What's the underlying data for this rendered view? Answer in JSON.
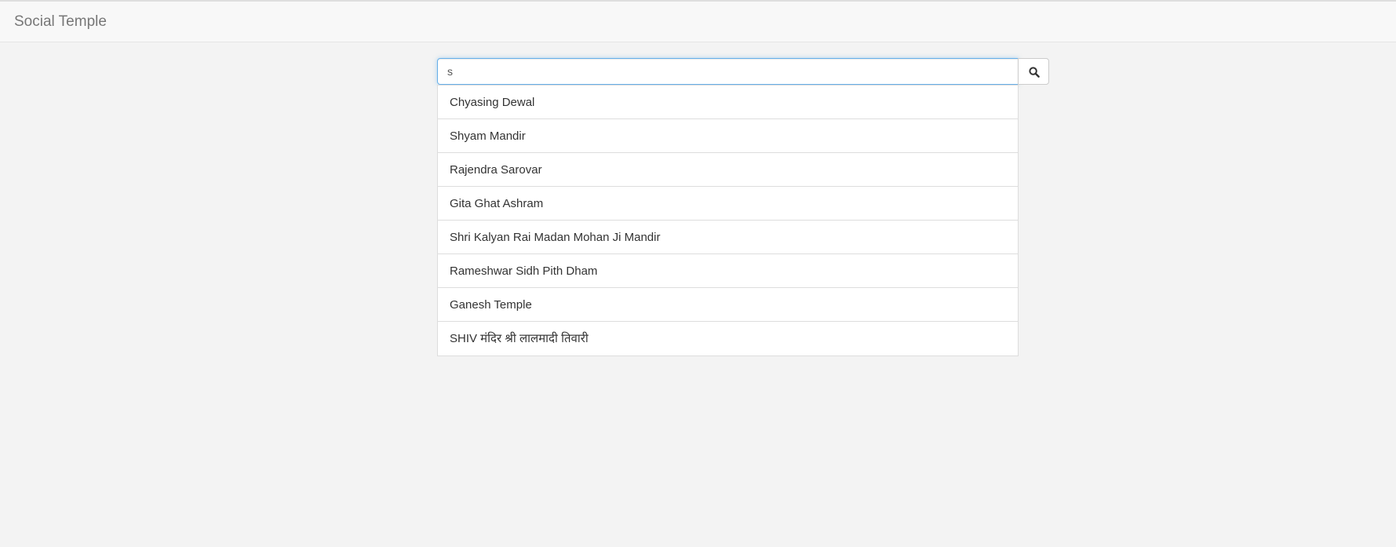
{
  "navbar": {
    "brand": "Social Temple"
  },
  "search": {
    "value": "s",
    "button_icon": "search-icon"
  },
  "suggestions": [
    "Chyasing Dewal",
    "Shyam Mandir",
    "Rajendra Sarovar",
    "Gita Ghat Ashram",
    "Shri Kalyan Rai Madan Mohan Ji Mandir",
    "Rameshwar Sidh Pith Dham",
    "Ganesh Temple",
    "SHIV मंदिर श्री लालमादी तिवारी"
  ],
  "colors": {
    "page_background": "#f3f3f3",
    "navbar_background": "#f8f8f8",
    "focus_border": "#66afe9",
    "text": "#333333",
    "brand_text": "#777777"
  }
}
